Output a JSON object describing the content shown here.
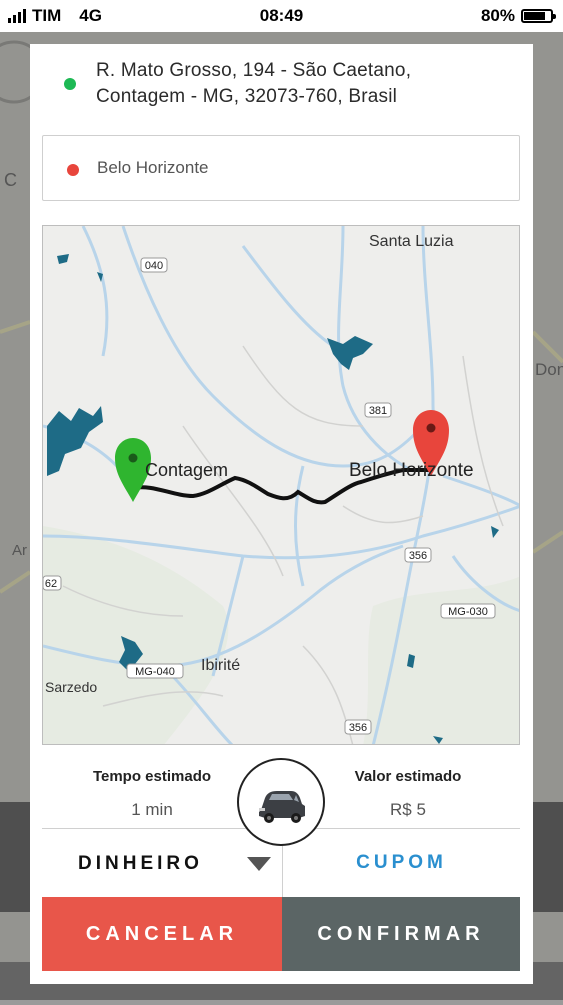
{
  "status_bar": {
    "carrier": "TIM",
    "network": "4G",
    "time": "08:49",
    "battery": "80%"
  },
  "background": {
    "left_letter_1": "C",
    "left_letter_2": "Ar",
    "right_text": "Don"
  },
  "route": {
    "origin_line1": "R. Mato Grosso, 194 - São Caetano,",
    "origin_line2": "Contagem - MG, 32073-760, Brasil",
    "destination": "Belo Horizonte",
    "origin_dot_color": "#1db954",
    "destination_dot_color": "#e8453c"
  },
  "map": {
    "labels": {
      "santa_luzia": "Santa Luzia",
      "contagem": "Contagem",
      "belo_horizonte": "Belo Horizonte",
      "ibirite": "Ibirité",
      "sarzedo": "Sarzedo"
    },
    "shields": {
      "r040": "040",
      "r381": "381",
      "r356a": "356",
      "r356b": "356",
      "r62": "62",
      "mg030": "MG-030",
      "mg040": "MG-040"
    },
    "origin_pin_color": "#2fb52f",
    "destination_pin_color": "#e8453c",
    "route_color": "#111111"
  },
  "estimates": {
    "time_label": "Tempo estimado",
    "time_value": "1 min",
    "price_label": "Valor estimado",
    "price_value": "R$  5",
    "vehicle_icon": "car-icon"
  },
  "payment": {
    "method": "DINHEIRO",
    "coupon": "CUPOM"
  },
  "actions": {
    "cancel": "CANCELAR",
    "confirm": "CONFIRMAR",
    "cancel_color": "#e8564a",
    "confirm_color": "#5b6565"
  }
}
